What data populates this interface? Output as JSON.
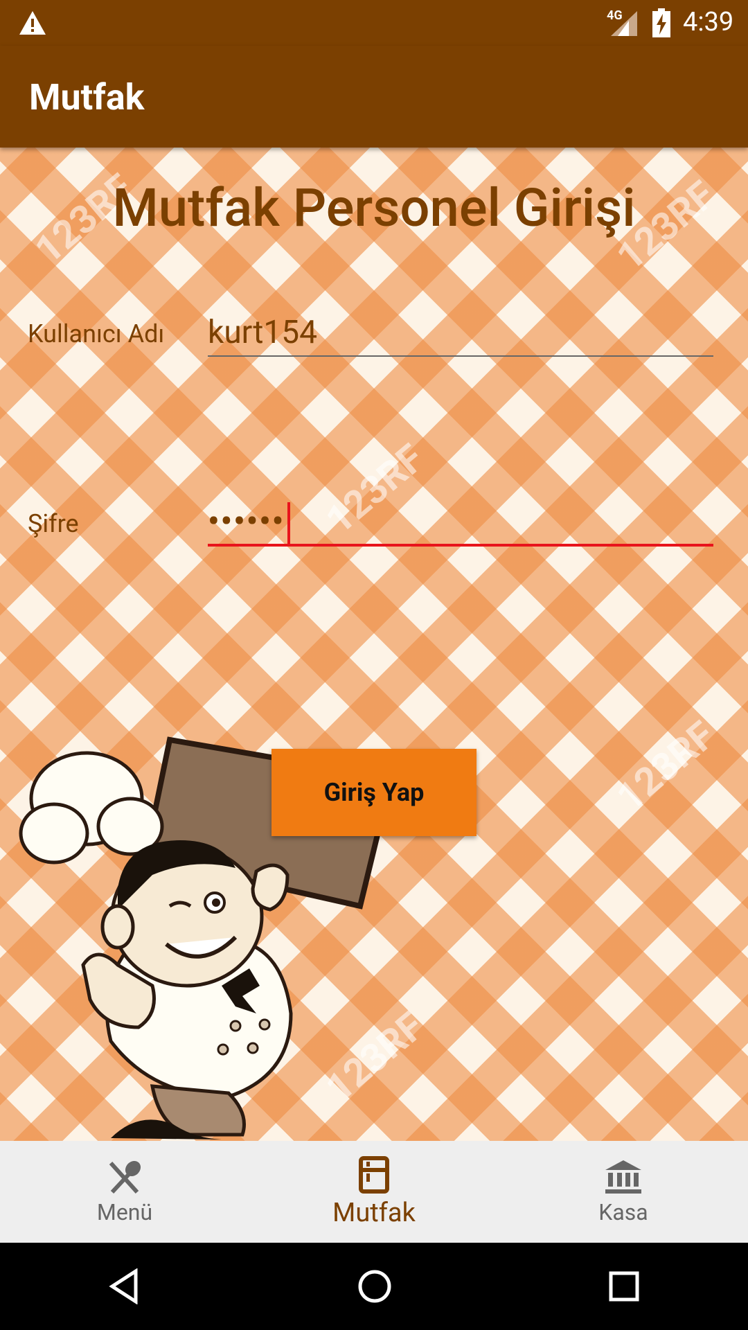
{
  "status_bar": {
    "time": "4:39",
    "network": "4G"
  },
  "app_bar": {
    "title": "Mutfak"
  },
  "login": {
    "heading": "Mutfak Personel Girişi",
    "username_label": "Kullanıcı Adı",
    "username_value": "kurt154",
    "password_label": "Şifre",
    "password_value": "••••••",
    "submit_label": "Giriş Yap"
  },
  "watermark_text": "123RF",
  "bottom_nav": {
    "items": [
      {
        "label": "Menü",
        "icon": "utensils-icon",
        "active": false
      },
      {
        "label": "Mutfak",
        "icon": "kitchen-icon",
        "active": true
      },
      {
        "label": "Kasa",
        "icon": "bank-icon",
        "active": false
      }
    ]
  },
  "colors": {
    "primary": "#7b4001",
    "accent": "#f07b12",
    "error_underline": "#e8141c"
  }
}
